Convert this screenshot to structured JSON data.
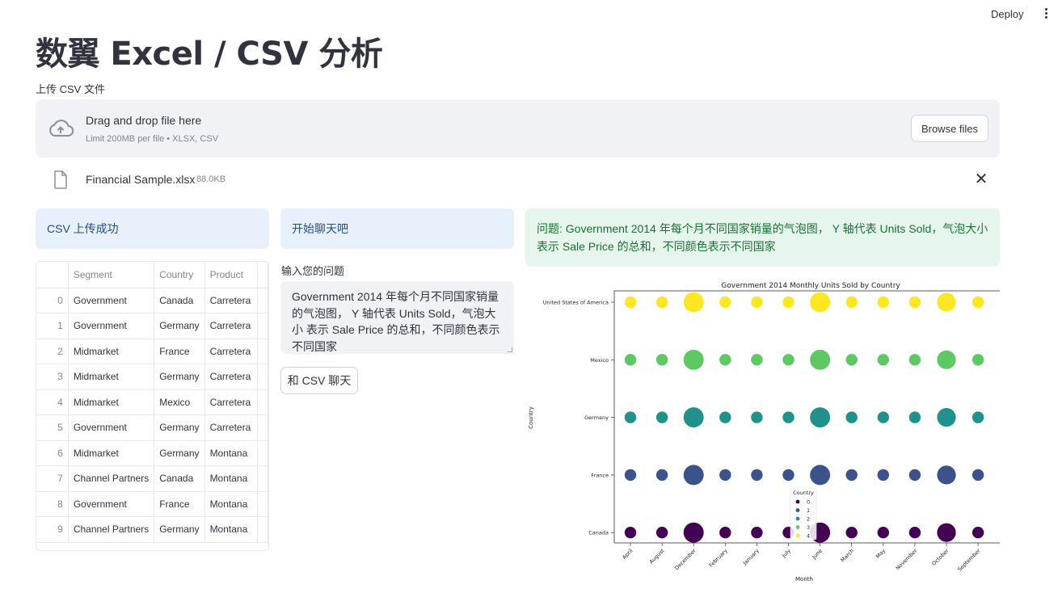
{
  "header": {
    "deploy_label": "Deploy",
    "menu_icon": "more-vertical-icon"
  },
  "page": {
    "title": "数翼 Excel / CSV 分析"
  },
  "uploader": {
    "label": "上传 CSV 文件",
    "drop_text": "Drag and drop file here",
    "limit_text": "Limit 200MB per file • XLSX, CSV",
    "browse_label": "Browse files",
    "icon": "cloud-upload-icon"
  },
  "uploaded_file": {
    "name": "Financial Sample.xlsx",
    "size": "88.0KB",
    "icon": "file-icon",
    "remove_icon": "close-icon"
  },
  "alerts": {
    "upload_success": "CSV 上传成功",
    "start_chat": "开始聊天吧",
    "question_line1": "问题: Government 2014 年每个月不同国家销量的气泡图， Y 轴代表 Units Sold，气泡大小",
    "question_line2": "表示 Sale Price 的总和，不同颜色表示不同国家"
  },
  "table": {
    "columns": [
      "",
      "Segment",
      "Country",
      "Product"
    ],
    "rows": [
      [
        "0",
        "Government",
        "Canada",
        "Carretera"
      ],
      [
        "1",
        "Government",
        "Germany",
        "Carretera"
      ],
      [
        "2",
        "Midmarket",
        "France",
        "Carretera"
      ],
      [
        "3",
        "Midmarket",
        "Germany",
        "Carretera"
      ],
      [
        "4",
        "Midmarket",
        "Mexico",
        "Carretera"
      ],
      [
        "5",
        "Government",
        "Germany",
        "Carretera"
      ],
      [
        "6",
        "Midmarket",
        "Germany",
        "Montana"
      ],
      [
        "7",
        "Channel Partners",
        "Canada",
        "Montana"
      ],
      [
        "8",
        "Government",
        "France",
        "Montana"
      ],
      [
        "9",
        "Channel Partners",
        "Germany",
        "Montana"
      ]
    ]
  },
  "chat": {
    "input_label": "输入您的问题",
    "input_value": "Government 2014 年每个月不同国家销量的气泡图， Y 轴代表 Units Sold，气泡大小 表示 Sale Price 的总和，不同颜色表示不同国家",
    "submit_label": "和 CSV 聊天"
  },
  "chart_data": {
    "type": "scatter",
    "title": "Government 2014 Monthly Units Sold by Country",
    "xlabel": "Month",
    "ylabel": "Country",
    "x": [
      "April",
      "August",
      "December",
      "February",
      "January",
      "July",
      "June",
      "March",
      "May",
      "November",
      "October",
      "September"
    ],
    "y": [
      "Canada",
      "France",
      "Germany",
      "Mexico",
      "United States of America"
    ],
    "bubble_size": [
      1,
      1,
      3,
      1,
      1,
      1,
      3,
      1,
      1,
      1,
      2.6,
      1
    ],
    "colors": [
      "#440154",
      "#3b528b",
      "#21918c",
      "#5ec962",
      "#fde725"
    ],
    "legend": {
      "title": "Country",
      "entries": [
        "0",
        "1",
        "2",
        "3",
        "4"
      ],
      "placement": "lower-center"
    }
  }
}
